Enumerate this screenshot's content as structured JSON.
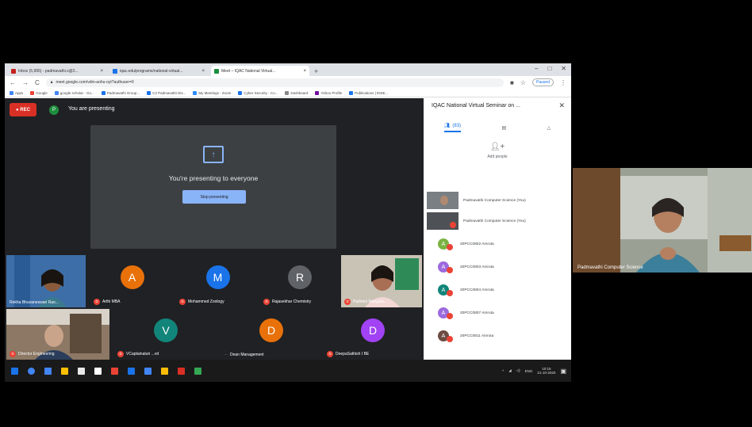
{
  "browser": {
    "tabs": [
      {
        "label": "Inbox (5,995) - padmavathi.s@2...",
        "color": "#c5221f",
        "active": false
      },
      {
        "label": "iqac.edu/programs/national-virtual...",
        "color": "#1a73e8",
        "active": false
      },
      {
        "label": "Meet – IQAC National Virtual...",
        "color": "#1e8e3e",
        "active": true
      }
    ],
    "new_tab": "+",
    "window_controls": [
      "–",
      "□",
      "✕"
    ],
    "url": "meet.google.com/vdm-aohu-oyt?authuser=0",
    "paused_label": "Paused",
    "bookmarks": [
      "Apps",
      "Google",
      "google scholar - Go...",
      "Padmavathi Group...",
      "C2 Padmavathi Dis...",
      "My Meetings - Zoom",
      "Cyber Security - Co...",
      "Dashboard",
      "Yahoo Profile",
      "Publications | INSE..."
    ]
  },
  "meet": {
    "rec_label": "● REC",
    "presenter_initial": "P",
    "presenting_label": "You are presenting",
    "presentation_message": "You're presenting to everyone",
    "stop_button": "Stop presenting",
    "tiles": [
      {
        "name": "Rekha Bhuvaneswari Rao...",
        "initial": "",
        "color": "#4a6fa5",
        "video": true
      },
      {
        "name": "Arthi MBA",
        "initial": "A",
        "color": "#e8710a",
        "video": false
      },
      {
        "name": "Mohammed Zoology",
        "initial": "M",
        "color": "#1a73e8",
        "video": false
      },
      {
        "name": "Rajasekhar Chemistry",
        "initial": "R",
        "color": "#5f6368",
        "video": false
      },
      {
        "name": "Padmini Mangala...",
        "initial": "",
        "color": "#b89d8a",
        "video": true
      },
      {
        "name": "Director Engineering",
        "initial": "",
        "color": "#7a6b5c",
        "video": true
      },
      {
        "name": "VCaptainaturi ...vd",
        "initial": "V",
        "color": "#12857a",
        "video": false
      },
      {
        "name": "Dean Management",
        "initial": "D",
        "color": "#e8710a",
        "video": false
      },
      {
        "name": "DeepaSathish I BE",
        "initial": "D",
        "color": "#a142f4",
        "video": false
      }
    ]
  },
  "panel": {
    "title": "IQAC National Virtual Seminar on ...",
    "close": "✕",
    "tab_people": "(83)",
    "add_people": "Add people",
    "rows": [
      {
        "name": "Padmavathi Computer Science (You)",
        "thumb": true,
        "initial": "",
        "color": "#6b7074"
      },
      {
        "name": "Padmavathi Computer Science (You)",
        "thumb": true,
        "initial": "",
        "color": "#555"
      },
      {
        "name": "20PCC0802 Amruta",
        "thumb": false,
        "initial": "A",
        "color": "#7cb342"
      },
      {
        "name": "20PCC0803 Amruta",
        "thumb": false,
        "initial": "A",
        "color": "#9c6ade"
      },
      {
        "name": "20PCC0804 Amruta",
        "thumb": false,
        "initial": "A",
        "color": "#12857a"
      },
      {
        "name": "20PCC0807 Amruta",
        "thumb": false,
        "initial": "A",
        "color": "#9c6ade"
      },
      {
        "name": "20PCC0811 Amruta",
        "thumb": false,
        "initial": "A",
        "color": "#6d4c41"
      }
    ]
  },
  "taskbar": {
    "icons": [
      "#1a73e8",
      "#4285f4",
      "#ffbf00",
      "#e8e8e8",
      "#ffffff",
      "#ea4335",
      "#1a73e8",
      "#4285f4",
      "#fbbc04",
      "#d93025",
      "#34a853"
    ],
    "clock": "10:15",
    "date": "21-10-2020",
    "lang": "ENG"
  },
  "camera": {
    "name": "Padmavathi Computer Science"
  }
}
